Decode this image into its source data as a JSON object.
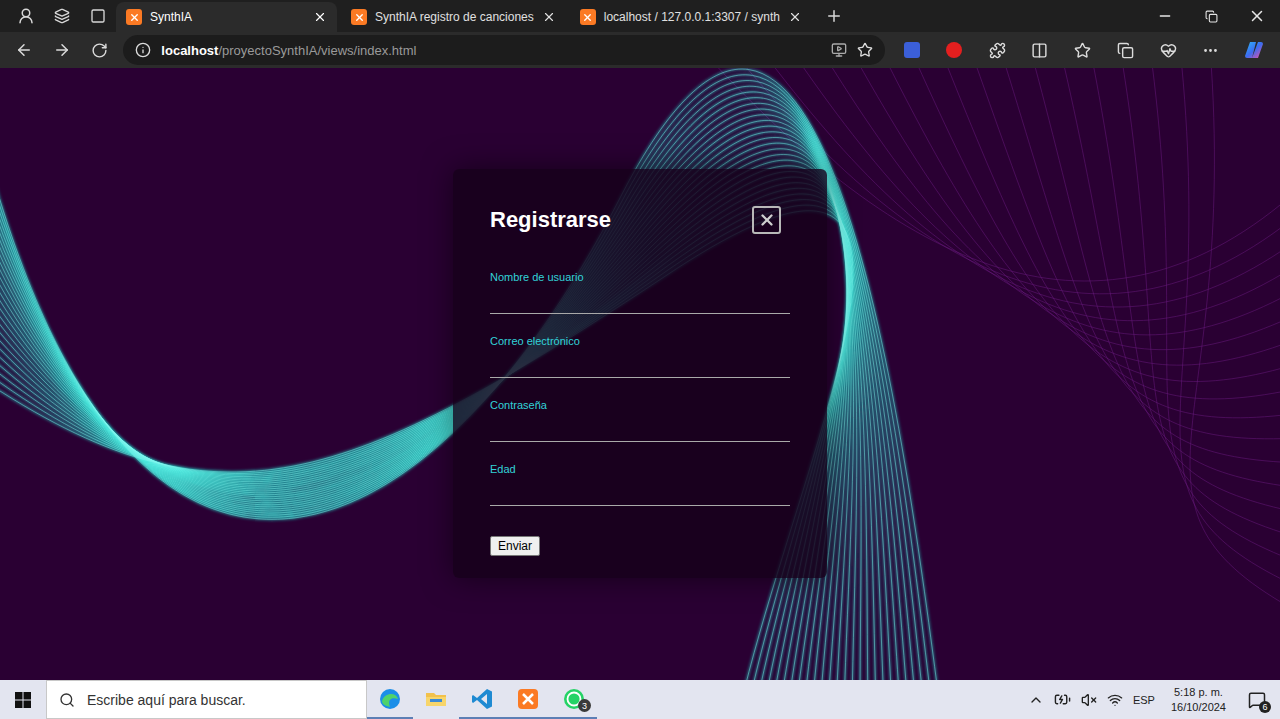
{
  "window": {
    "tabs": [
      {
        "label": "SynthIA",
        "selected": true
      },
      {
        "label": "SynthIA registro de canciones",
        "selected": false
      },
      {
        "label": "localhost / 127.0.0.1:3307 / synth",
        "selected": false
      }
    ]
  },
  "address_bar": {
    "host": "localhost",
    "path": "/proyectoSynthIA/views/index.html"
  },
  "form": {
    "title": "Registrarse",
    "fields": [
      {
        "label": "Nombre de usuario"
      },
      {
        "label": "Correo electrónico"
      },
      {
        "label": "Contraseña"
      },
      {
        "label": "Edad"
      }
    ],
    "submit": "Enviar"
  },
  "taskbar": {
    "search_placeholder": "Escribe aquí para buscar.",
    "apps": [
      {
        "kind": "edge",
        "active": true
      },
      {
        "kind": "explorer",
        "active": false
      },
      {
        "kind": "vscode",
        "active": true
      },
      {
        "kind": "xampp",
        "active": true
      },
      {
        "kind": "whatsapp",
        "active": true,
        "badge": "3"
      }
    ],
    "language": "ESP",
    "time": "5:18 p. m.",
    "date": "16/10/2024",
    "notifications": "6"
  }
}
